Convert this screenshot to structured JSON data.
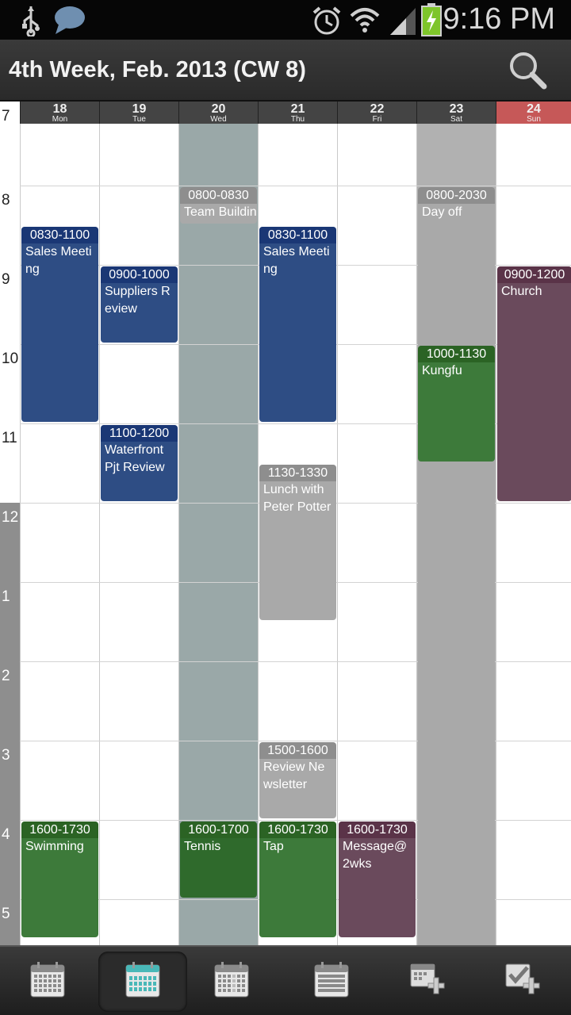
{
  "status_bar": {
    "time": "9:16 PM",
    "icons": [
      "usb-icon",
      "chat-bubble-icon",
      "alarm-icon",
      "wifi-icon",
      "signal-icon",
      "battery-charging-icon"
    ]
  },
  "header": {
    "title": "4th Week, Feb. 2013 (CW 8)",
    "search_icon": "search-icon"
  },
  "hours": [
    "7",
    "8",
    "9",
    "10",
    "11",
    "12",
    "1",
    "2",
    "3",
    "4",
    "5"
  ],
  "days": [
    {
      "num": "18",
      "name": "Mon"
    },
    {
      "num": "19",
      "name": "Tue"
    },
    {
      "num": "20",
      "name": "Wed"
    },
    {
      "num": "21",
      "name": "Thu"
    },
    {
      "num": "22",
      "name": "Fri"
    },
    {
      "num": "23",
      "name": "Sat"
    },
    {
      "num": "24",
      "name": "Sun"
    }
  ],
  "events": [
    {
      "day": 0,
      "start": 8.5,
      "end": 11,
      "time": "0830-1100",
      "title": "Sales Meeting",
      "color": "blue"
    },
    {
      "day": 0,
      "start": 16,
      "end": 17.5,
      "time": "1600-1730",
      "title": "Swimming",
      "color": "green"
    },
    {
      "day": 1,
      "start": 9,
      "end": 10,
      "time": "0900-1000",
      "title": "Suppliers Review",
      "color": "blue"
    },
    {
      "day": 1,
      "start": 11,
      "end": 12,
      "time": "1100-1200",
      "title": "Waterfront Pjt Review",
      "color": "blue"
    },
    {
      "day": 2,
      "start": 8,
      "end": 8.5,
      "time": "0800-0830",
      "title": "Team Building",
      "color": "gray"
    },
    {
      "day": 2,
      "start": 16,
      "end": 17,
      "time": "1600-1700",
      "title": "Tennis",
      "color": "dkgreen"
    },
    {
      "day": 3,
      "start": 8.5,
      "end": 11,
      "time": "0830-1100",
      "title": "Sales Meeting",
      "color": "blue"
    },
    {
      "day": 3,
      "start": 11.5,
      "end": 13.5,
      "time": "1130-1330",
      "title": "Lunch with Peter Potter",
      "color": "gray"
    },
    {
      "day": 3,
      "start": 15,
      "end": 16,
      "time": "1500-1600",
      "title": "Review Newsletter",
      "color": "gray"
    },
    {
      "day": 3,
      "start": 16,
      "end": 17.5,
      "time": "1600-1730",
      "title": "Tap",
      "color": "green"
    },
    {
      "day": 4,
      "start": 16,
      "end": 17.5,
      "time": "1600-1730",
      "title": "Message@2wks",
      "color": "maroon"
    },
    {
      "day": 5,
      "start": 8,
      "end": 20.5,
      "time": "0800-2030",
      "title": "Day off",
      "color": "gray"
    },
    {
      "day": 5,
      "start": 10,
      "end": 11.5,
      "time": "1000-1130",
      "title": "Kungfu",
      "color": "green"
    },
    {
      "day": 6,
      "start": 9,
      "end": 12,
      "time": "0900-1200",
      "title": "Church",
      "color": "maroon"
    }
  ],
  "bottom_tabs": [
    {
      "name": "month-view-icon",
      "active": false
    },
    {
      "name": "week-view-icon",
      "active": true
    },
    {
      "name": "day-view-icon",
      "active": false
    },
    {
      "name": "agenda-view-icon",
      "active": false
    },
    {
      "name": "add-event-icon",
      "active": false
    },
    {
      "name": "add-task-icon",
      "active": false
    }
  ],
  "colors": {
    "blue": "#2e4d84",
    "green": "#3d7a3a",
    "gray": "#a9a9a9",
    "maroon": "#6a4a5c",
    "sunday_header": "#c65858"
  }
}
